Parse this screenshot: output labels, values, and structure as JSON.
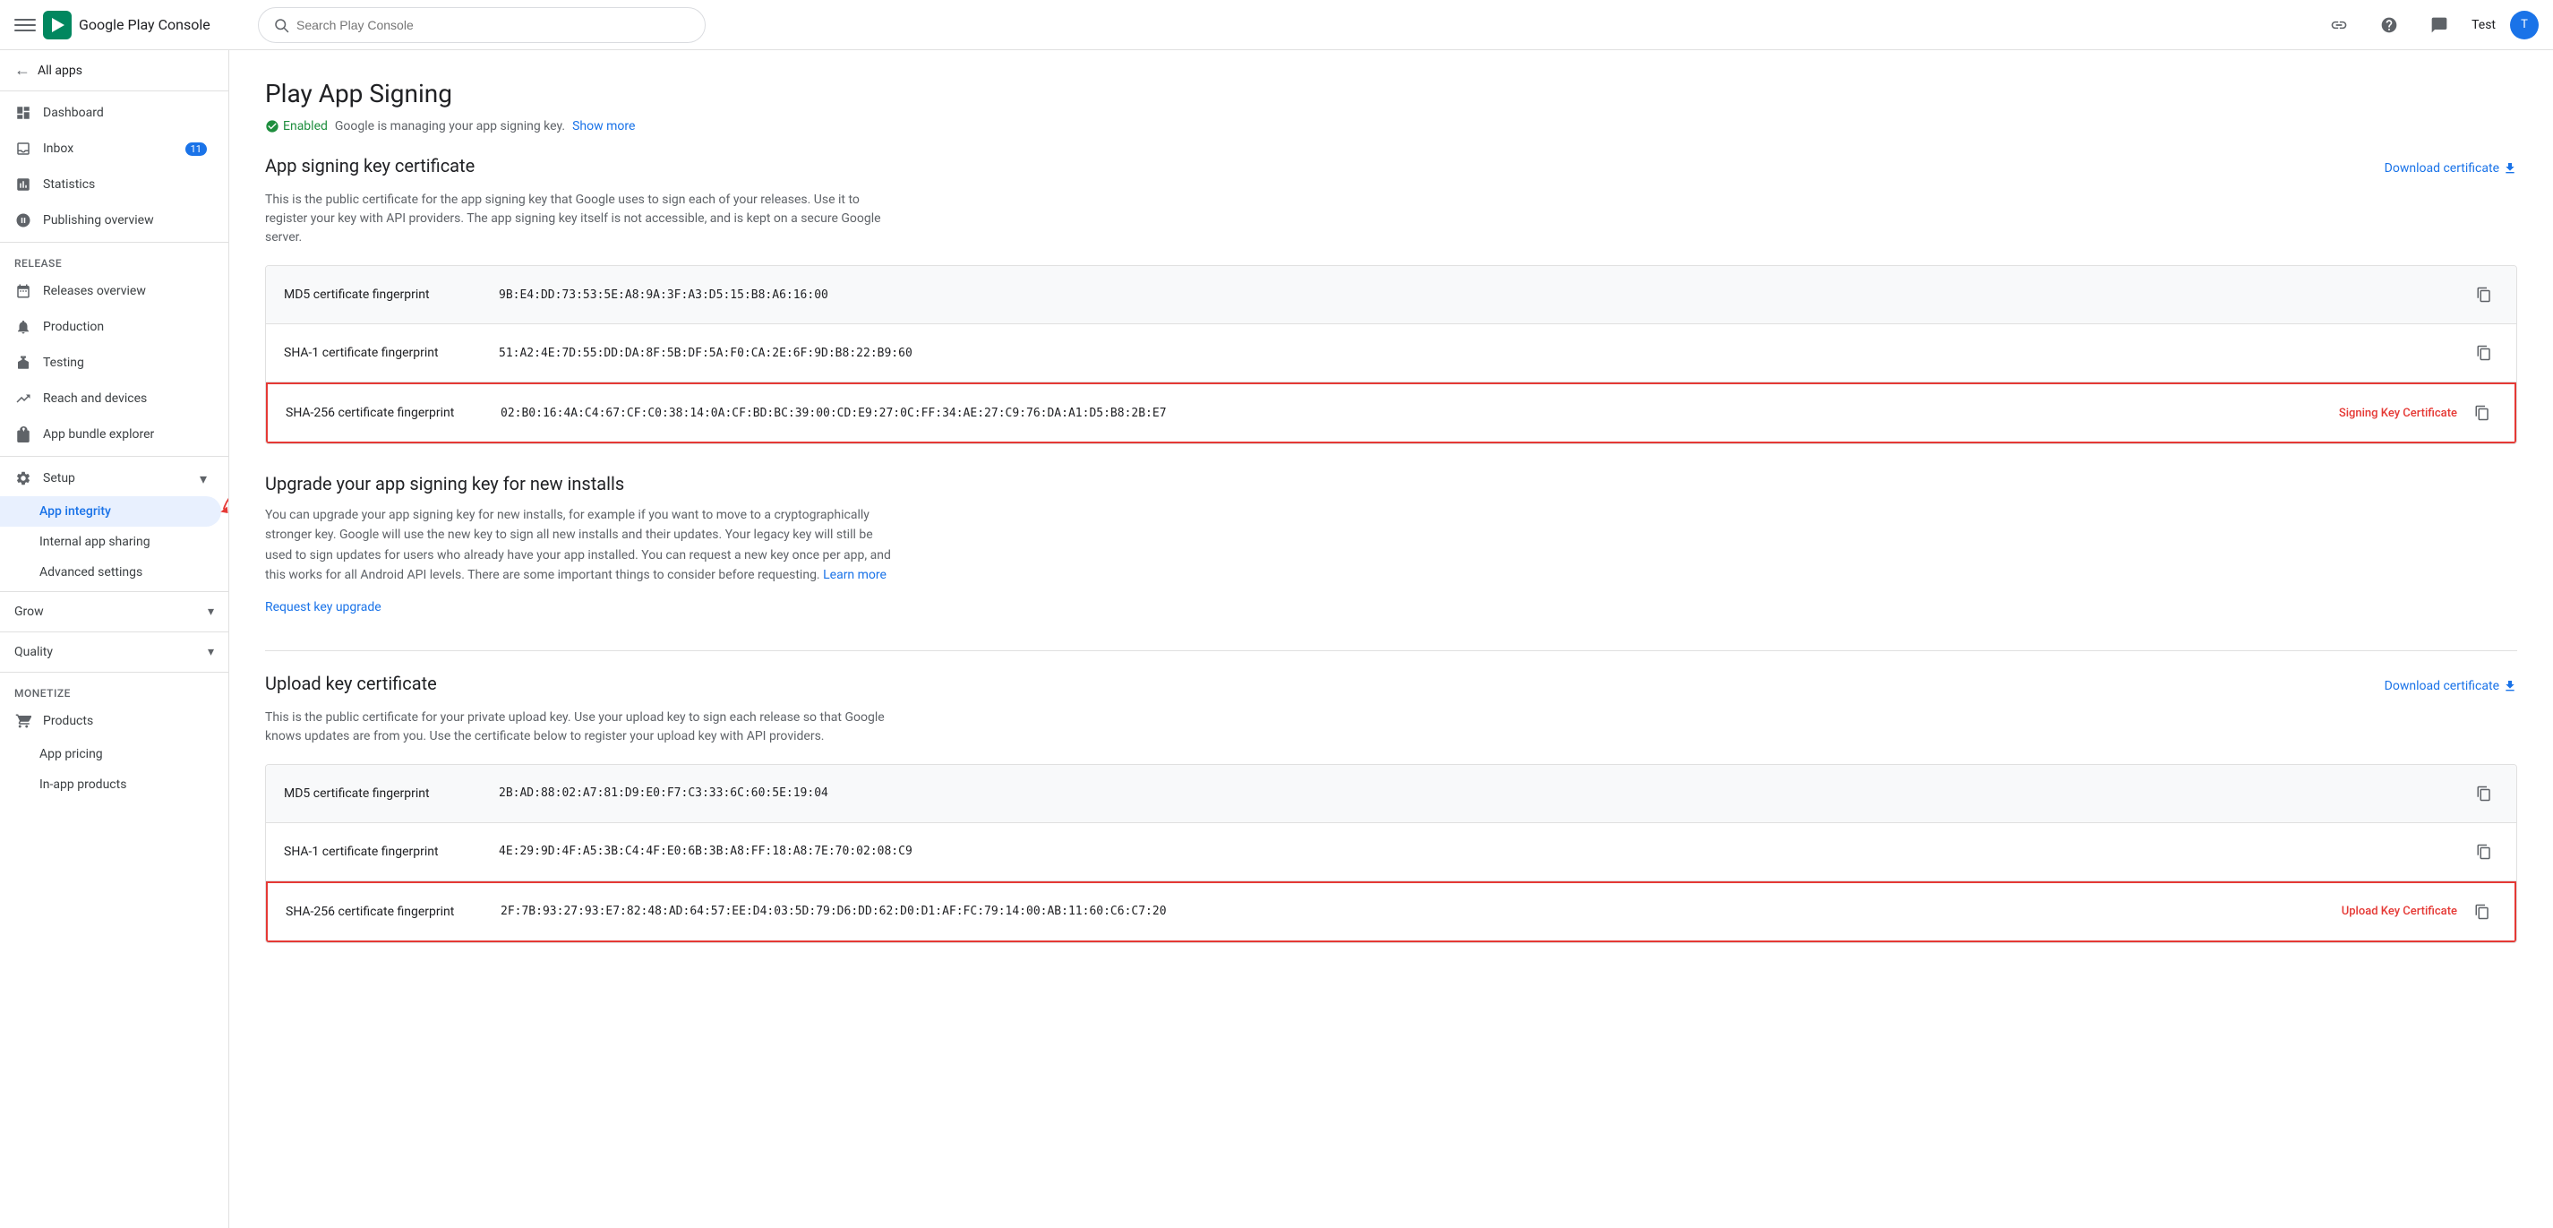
{
  "topbar": {
    "logo_text": "Google Play Console",
    "search_placeholder": "Search Play Console",
    "link_icon": "🔗",
    "help_icon": "?",
    "feedback_icon": "✉",
    "user_label": "Test",
    "user_initials": "T"
  },
  "sidebar": {
    "all_apps_label": "All apps",
    "nav_items": [
      {
        "id": "dashboard",
        "label": "Dashboard",
        "icon": "⊞"
      },
      {
        "id": "inbox",
        "label": "Inbox",
        "icon": "✉",
        "badge": "11"
      },
      {
        "id": "statistics",
        "label": "Statistics",
        "icon": "📊"
      },
      {
        "id": "publishing",
        "label": "Publishing overview",
        "icon": "📡"
      }
    ],
    "release_section": "Release",
    "release_items": [
      {
        "id": "releases-overview",
        "label": "Releases overview",
        "icon": "🚀"
      },
      {
        "id": "production",
        "label": "Production",
        "icon": "🔔"
      },
      {
        "id": "testing",
        "label": "Testing",
        "icon": "🧪"
      },
      {
        "id": "reach-devices",
        "label": "Reach and devices",
        "icon": "📈"
      },
      {
        "id": "app-bundle",
        "label": "App bundle explorer",
        "icon": "📦"
      }
    ],
    "setup_section": "Setup",
    "setup_items": [
      {
        "id": "setup",
        "label": "Setup",
        "icon": "⚙"
      }
    ],
    "setup_sub_items": [
      {
        "id": "app-integrity",
        "label": "App integrity",
        "active": true
      },
      {
        "id": "internal-sharing",
        "label": "Internal app sharing"
      },
      {
        "id": "advanced-settings",
        "label": "Advanced settings"
      }
    ],
    "grow_section": "Grow",
    "quality_section": "Quality",
    "monetize_section": "Monetize",
    "monetize_items": [
      {
        "id": "products",
        "label": "Products",
        "icon": "🛒"
      },
      {
        "id": "app-pricing",
        "label": "App pricing"
      },
      {
        "id": "in-app-products",
        "label": "In-app products"
      }
    ]
  },
  "content": {
    "page_title": "Play App Signing",
    "status_enabled": "Enabled",
    "status_desc": "Google is managing your app signing key.",
    "show_more_label": "Show more",
    "app_signing_section": {
      "title": "App signing key certificate",
      "download_label": "Download certificate",
      "description": "This is the public certificate for the app signing key that Google uses to sign each of your releases. Use it to register your key with API providers. The app signing key itself is not accessible, and is kept on a secure Google server.",
      "rows": [
        {
          "id": "md5",
          "label": "MD5 certificate fingerprint",
          "value": "9B:E4:DD:73:53:5E:A8:9A:3F:A3:D5:15:B8:A6:16:00",
          "highlighted": false,
          "tag": ""
        },
        {
          "id": "sha1",
          "label": "SHA-1 certificate fingerprint",
          "value": "51:A2:4E:7D:55:DD:DA:8F:5B:DF:5A:F0:CA:2E:6F:9D:B8:22:B9:60",
          "highlighted": false,
          "tag": ""
        },
        {
          "id": "sha256",
          "label": "SHA-256 certificate fingerprint",
          "value": "02:B0:16:4A:C4:67:CF:C0:38:14:0A:CF:BD:BC:39:00:CD:E9:27:0C:FF:34:AE:27:C9:76:DA:A1:D5:B8:2B:E7",
          "highlighted": true,
          "tag": "Signing Key Certificate"
        }
      ]
    },
    "upgrade_section": {
      "title": "Upgrade your app signing key for new installs",
      "description": "You can upgrade your app signing key for new installs, for example if you want to move to a cryptographically stronger key. Google will use the new key to sign all new installs and their updates. Your legacy key will still be used to sign updates for users who already have your app installed. You can request a new key once per app, and this works for all Android API levels. There are some important things to consider before requesting.",
      "learn_more_label": "Learn more",
      "request_label": "Request key upgrade"
    },
    "upload_key_section": {
      "title": "Upload key certificate",
      "download_label": "Download certificate",
      "description": "This is the public certificate for your private upload key. Use your upload key to sign each release so that Google knows updates are from you. Use the certificate below to register your upload key with API providers.",
      "rows": [
        {
          "id": "upload-md5",
          "label": "MD5 certificate fingerprint",
          "value": "2B:AD:88:02:A7:81:D9:E0:F7:C3:33:6C:60:5E:19:04",
          "highlighted": false,
          "tag": ""
        },
        {
          "id": "upload-sha1",
          "label": "SHA-1 certificate fingerprint",
          "value": "4E:29:9D:4F:A5:3B:C4:4F:E0:6B:3B:A8:FF:18:A8:7E:70:02:08:C9",
          "highlighted": false,
          "tag": ""
        },
        {
          "id": "upload-sha256",
          "label": "SHA-256 certificate fingerprint",
          "value": "2F:7B:93:27:93:E7:82:48:AD:64:57:EE:D4:03:5D:79:D6:DD:62:D0:D1:AF:FC:79:14:00:AB:11:60:C6:C7:20",
          "highlighted": true,
          "tag": "Upload Key Certificate"
        }
      ]
    }
  }
}
